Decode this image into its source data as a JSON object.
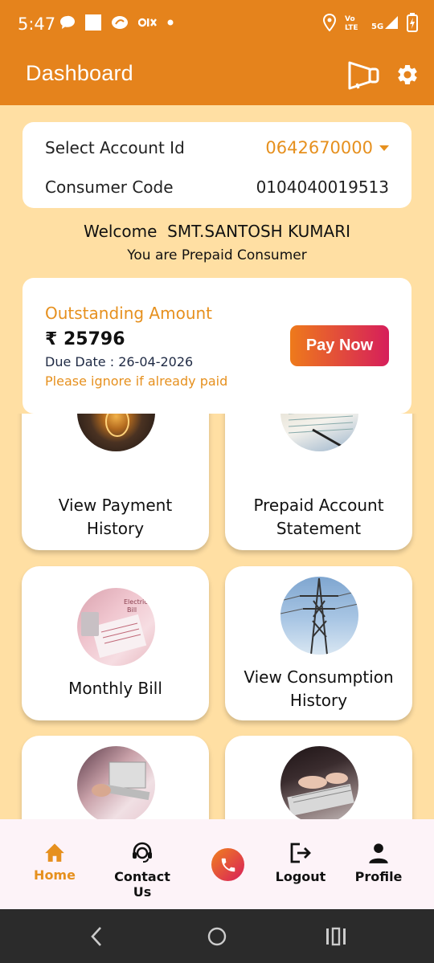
{
  "status_bar": {
    "time": "5:47",
    "left_icons": [
      "chat-icon",
      "square-icon",
      "app-icon",
      "olx-icon",
      "dot-icon"
    ],
    "right_icons": [
      "location-icon",
      "volte-icon",
      "signal-5g-icon",
      "battery-charging-icon"
    ],
    "network_label": "5G",
    "volte_label": "Vo LTE"
  },
  "app_bar": {
    "title": "Dashboard",
    "icons": [
      "announcement-icon",
      "gear-icon"
    ]
  },
  "account": {
    "select_label": "Select Account Id",
    "account_id": "0642670000",
    "consumer_label": "Consumer Code",
    "consumer_code": "0104040019513"
  },
  "welcome": {
    "greeting": "Welcome  SMT.SANTOSH KUMARI",
    "subtitle": "You are Prepaid Consumer"
  },
  "outstanding": {
    "title": "Outstanding Amount",
    "amount": "₹ 25796",
    "due_date": "Due Date : 26-04-2026",
    "note": "Please ignore if already paid",
    "pay_label": "Pay Now"
  },
  "tiles": [
    {
      "label_line1": "View Payment",
      "label_line2": "History",
      "image": "light-bulb-photo"
    },
    {
      "label_line1": "Prepaid Account",
      "label_line2": "Statement",
      "image": "statement-photo"
    },
    {
      "label_line1": "Monthly Bill",
      "label_line2": "",
      "image": "electric-bill-photo"
    },
    {
      "label_line1": "View Consumption",
      "label_line2": "History",
      "image": "power-tower-photo"
    },
    {
      "label_line1": "",
      "label_line2": "",
      "image": "laptop-photo"
    },
    {
      "label_line1": "",
      "label_line2": "",
      "image": "typing-photo"
    }
  ],
  "bottom_nav": {
    "items": [
      {
        "label": "Home",
        "icon": "home-icon"
      },
      {
        "label": "Contact Us",
        "icon": "support-agent-icon"
      },
      {
        "label": "",
        "icon": "phone-icon"
      },
      {
        "label": "Logout",
        "icon": "logout-icon"
      },
      {
        "label": "Profile",
        "icon": "person-icon"
      }
    ]
  },
  "colors": {
    "primary": "#E5831C",
    "background": "#FFDFA3",
    "accent_text": "#E6901E",
    "pay_gradient_start": "#EE7A1B",
    "pay_gradient_end": "#D61E5B"
  }
}
